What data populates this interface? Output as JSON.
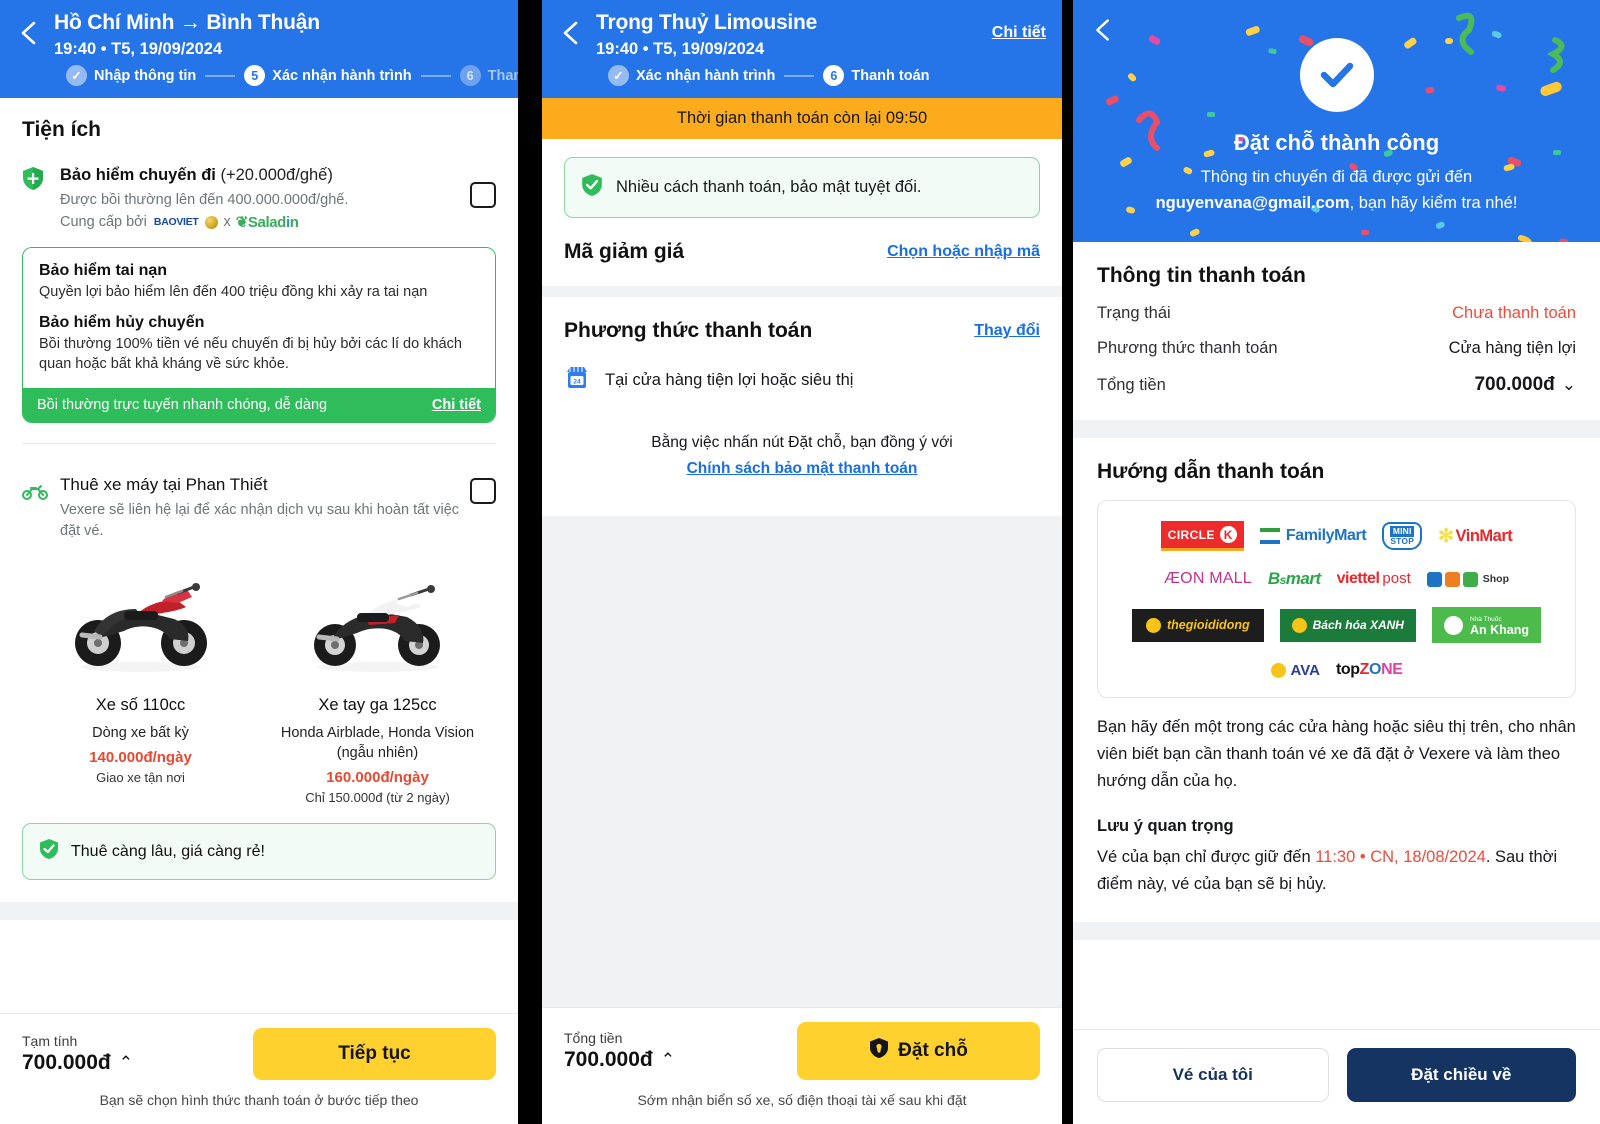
{
  "panel1": {
    "header": {
      "back_icon": "arrow-left-icon",
      "title": "Hồ Chí Minh → Bình Thuận",
      "subtitle": "19:40 • T5, 19/09/2024",
      "steps": [
        {
          "badge": "✓",
          "label": "Nhập thông tin",
          "state": "done"
        },
        {
          "badge": "5",
          "label": "Xác nhận hành trình",
          "state": "current"
        },
        {
          "badge": "6",
          "label": "Thanh toán",
          "state": "todo"
        }
      ]
    },
    "section_title": "Tiện ích",
    "insurance": {
      "icon": "shield-icon",
      "title_bold": "Bảo hiểm chuyến đi",
      "title_plain": " (+20.000đ/ghế)",
      "desc": "Được bồi thường lên đến 400.000.000đ/ghế.",
      "provider_prefix": "Cung cấp bởi",
      "provider_baoviet": "BAOVIET",
      "provider_x": "x",
      "provider_saladin_a": "Salad",
      "provider_saladin_b": "i",
      "provider_saladin_c": "n",
      "checkbox": "unchecked"
    },
    "insurance_card": {
      "item1_title": "Bảo hiểm tai nạn",
      "item1_desc": "Quyền lợi bảo hiểm lên đến 400 triệu đồng khi xảy ra tai nạn",
      "item2_title": "Bảo hiểm hủy chuyến",
      "item2_desc": "Bồi thường 100% tiền vé nếu chuyến đi bị hủy bởi các lí do khách quan hoặc bất khả kháng về sức khỏe.",
      "footer_text": "Bồi thường trực tuyến nhanh chóng, dễ dàng",
      "footer_link": "Chi tiết"
    },
    "bike_rental": {
      "icon": "motorbike-icon",
      "title": "Thuê xe máy tại Phan Thiết",
      "desc": "Vexere sẽ liên hệ lại để xác nhận dịch vụ sau khi hoàn tất việc đặt vé.",
      "checkbox": "unchecked",
      "options": [
        {
          "image": "motorbike-red-photo",
          "name": "Xe số 110cc",
          "model": "Dòng xe bất kỳ",
          "price": "140.000đ/ngày",
          "note": "Giao xe tận nơi"
        },
        {
          "image": "motorbike-white-photo",
          "name": "Xe tay ga 125cc",
          "model": "Honda Airblade, Honda Vision (ngẫu nhiên)",
          "price": "160.000đ/ngày",
          "note": "Chỉ 150.000đ (từ 2 ngày)"
        }
      ],
      "tip_icon": "shield-check-icon",
      "tip": "Thuê càng lâu, giá càng rẻ!"
    },
    "footer": {
      "amount_label": "Tạm tính",
      "amount": "700.000đ",
      "caret": "⌃",
      "button": "Tiếp tục",
      "note": "Bạn sẽ chọn hình thức thanh toán ở bước tiếp theo"
    }
  },
  "panel2": {
    "header": {
      "back_icon": "arrow-left-icon",
      "title": "Trọng Thuỷ Limousine",
      "subtitle": "19:40 • T5, 19/09/2024",
      "detail_link": "Chi tiết",
      "steps": [
        {
          "badge": "✓",
          "label": "Xác nhận hành trình",
          "state": "done"
        },
        {
          "badge": "6",
          "label": "Thanh toán",
          "state": "current"
        }
      ]
    },
    "timer": "Thời gian thanh toán còn lại 09:50",
    "notice_icon": "shield-check-icon",
    "notice": "Nhiều cách thanh toán, bảo mật tuyệt đối.",
    "discount": {
      "title": "Mã giảm giá",
      "link": "Chọn hoặc nhập mã"
    },
    "payment": {
      "title": "Phương thức thanh toán",
      "link": "Thay đổi",
      "method_icon": "store-24h-icon",
      "method": "Tại cửa hàng tiện lợi hoặc siêu thị",
      "agree_text": "Bằng việc nhấn nút Đặt chỗ, bạn đồng ý với",
      "agree_link": "Chính sách bảo mật thanh toán"
    },
    "footer": {
      "amount_label": "Tổng tiền",
      "amount": "700.000đ",
      "caret": "⌃",
      "button_icon": "shield-icon",
      "button": "Đặt chỗ",
      "note": "Sớm nhận biển số xe, số điện thoại tài xế sau khi đặt"
    }
  },
  "panel3": {
    "back_icon": "arrow-left-icon",
    "success_icon": "check-circle-icon",
    "success_title": "Đặt chỗ thành công",
    "success_sub_pre": "Thông tin chuyến đi đã được gửi đến",
    "success_email": "nguyenvana@gmail.com",
    "success_sub_post": ", bạn hãy kiểm tra nhé!",
    "payment_info": {
      "title": "Thông tin thanh toán",
      "rows": [
        {
          "key": "Trạng thái",
          "value": "Chưa thanh toán",
          "style": "red"
        },
        {
          "key": "Phương thức thanh toán",
          "value": "Cửa hàng tiện lợi",
          "style": "normal"
        },
        {
          "key": "Tổng tiền",
          "value": "700.000đ",
          "style": "bold",
          "caret": "⌄"
        }
      ]
    },
    "guide": {
      "title": "Hướng dẫn thanh toán",
      "logos": [
        [
          "CIRCLE K",
          "FamilyMart",
          "MINI STOP",
          "VinMart"
        ],
        [
          "ÆON MALL",
          "B's mart",
          "viettel post",
          "FPT Shop"
        ],
        [
          "thegioididong",
          "Bách hóa XANH",
          "An Khang"
        ],
        [
          "AVA",
          "topZONE"
        ]
      ],
      "paragraph": "Bạn hãy đến một trong các cửa hàng hoặc siêu thị trên, cho nhân viên biết bạn cần thanh toán vé xe đã đặt ở Vexere và làm theo hướng dẫn của họ.",
      "note_title": "Lưu ý quan trọng",
      "note_pre": "Vé của bạn chỉ được giữ đến ",
      "note_red": "11:30 • CN, 18/08/2024",
      "note_post": ". Sau thời điểm này, vé của bạn sẽ bị hủy."
    },
    "footer": {
      "secondary": "Vé của tôi",
      "primary": "Đặt chiều về"
    }
  },
  "colors": {
    "brand_blue": "#2574e8",
    "accent_yellow": "#ffd12e",
    "timer_orange": "#fbab1c",
    "green": "#2fbd5c",
    "red": "#f0493c",
    "navy": "#163462"
  }
}
